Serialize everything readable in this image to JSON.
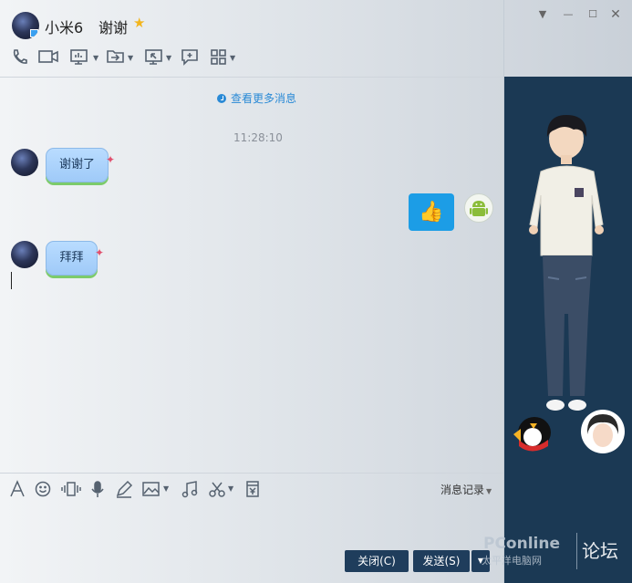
{
  "header": {
    "name": "小米6",
    "signature": "谢谢",
    "star_icon": "star-icon",
    "window_controls": [
      "minimize-arrow",
      "minimize",
      "maximize",
      "close"
    ],
    "toolbar_icons": [
      "phone-icon",
      "video-icon",
      "screen-share-icon",
      "transfer-file-icon",
      "remote-assist-icon",
      "add-note-icon",
      "apps-icon"
    ]
  },
  "chat": {
    "view_more": "查看更多消息",
    "timestamp": "11:28:10",
    "messages": [
      {
        "from": "other",
        "text": "谢谢了"
      },
      {
        "from": "self",
        "text": "👍"
      },
      {
        "from": "other",
        "text": "拜拜"
      }
    ]
  },
  "input": {
    "tools": [
      "font-icon",
      "emoji-icon",
      "shake-icon",
      "voice-icon",
      "pen-icon",
      "image-icon",
      "music-icon",
      "screenshot-icon",
      "red-packet-icon"
    ],
    "history_label": "消息记录",
    "close_button": "关闭(C)",
    "send_button": "发送(S)"
  },
  "watermark": {
    "brand": "PConline",
    "brand_cn": "太平洋电脑网",
    "forum": "论坛"
  },
  "colors": {
    "side_panel": "#1b3954",
    "button": "#1f3d5c",
    "link": "#2a8ad6",
    "like_bubble": "#1c9de6"
  }
}
